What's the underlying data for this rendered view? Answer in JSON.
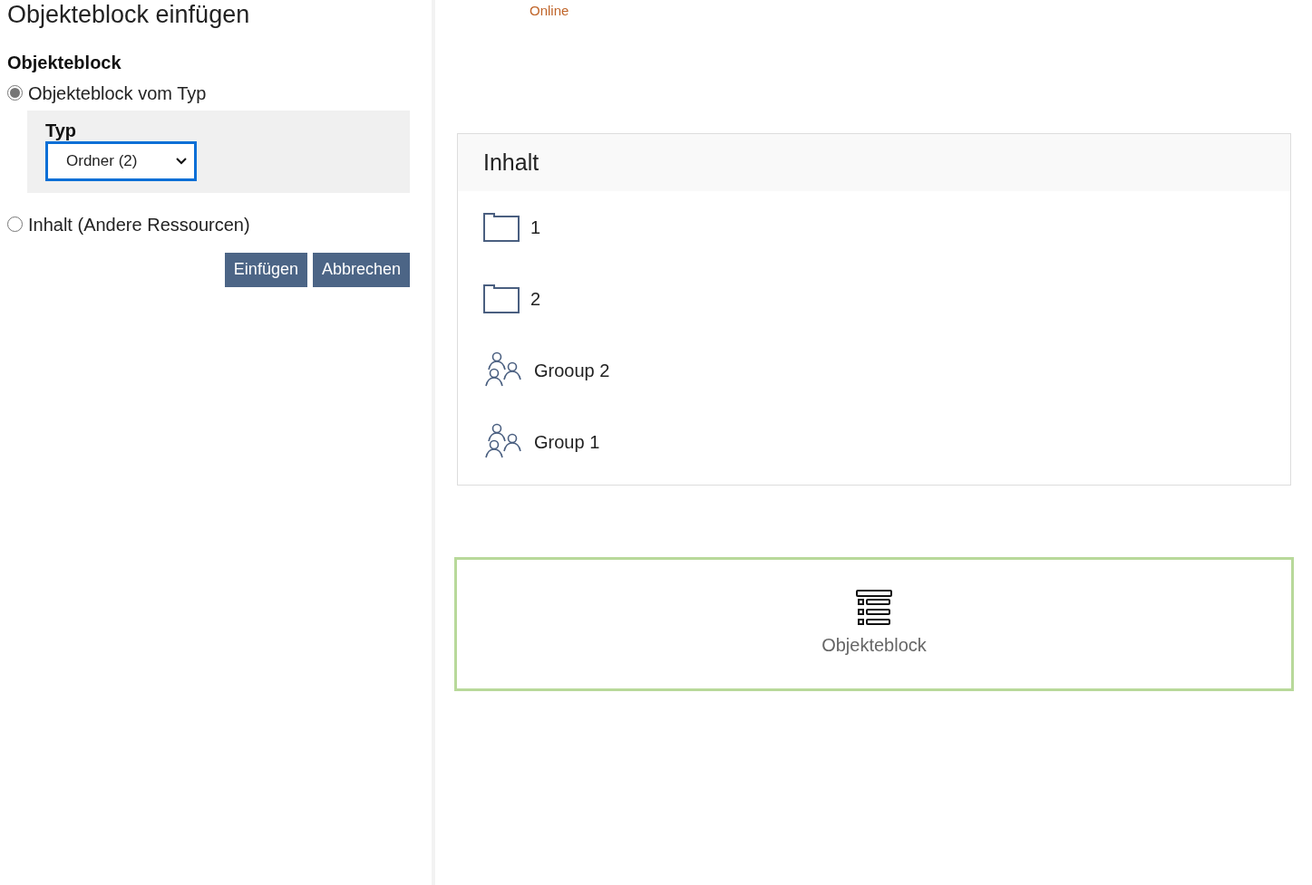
{
  "panel": {
    "title": "Objekteblock einfügen",
    "section_label": "Objekteblock",
    "options": [
      {
        "label": "Objekteblock vom Typ",
        "selected": true
      },
      {
        "label": "Inhalt (Andere Ressourcen)",
        "selected": false
      }
    ],
    "type_field": {
      "label": "Typ",
      "value": "Ordner (2)"
    },
    "buttons": [
      "Einfügen",
      "Abbrechen"
    ]
  },
  "status": "Online",
  "content": {
    "title": "Inhalt",
    "items": [
      {
        "kind": "folder",
        "label": "1"
      },
      {
        "kind": "folder",
        "label": "2"
      },
      {
        "kind": "group",
        "label": "Grooup 2"
      },
      {
        "kind": "group",
        "label": "Group 1"
      }
    ]
  },
  "block": {
    "label": "Objekteblock"
  }
}
